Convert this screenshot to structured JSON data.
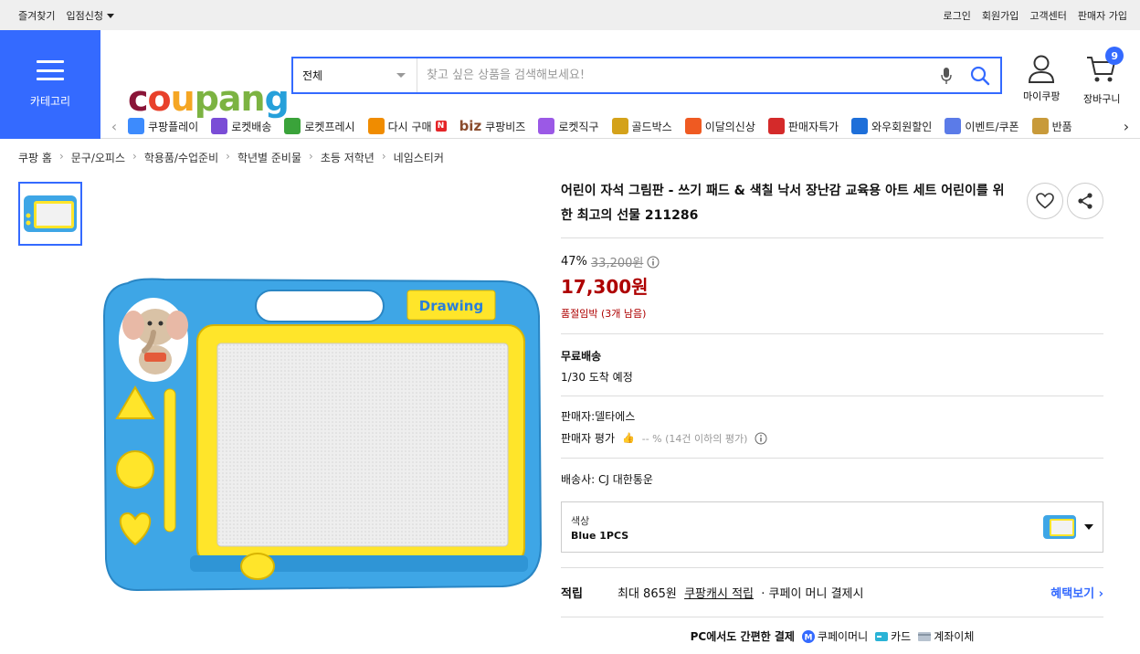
{
  "topbar": {
    "left": [
      "즐겨찾기",
      "입점신청"
    ],
    "right": [
      "로그인",
      "회원가입",
      "고객센터",
      "판매자 가입"
    ]
  },
  "header": {
    "category_label": "카테고리",
    "logo": {
      "c": "c",
      "o": "o",
      "u": "u",
      "pan": "pan",
      "g": "g"
    },
    "search": {
      "scope": "전체",
      "placeholder": "찾고 싶은 상품을 검색해보세요!"
    },
    "mycoupang_label": "마이쿠팡",
    "cart_label": "장바구니",
    "cart_count": "9"
  },
  "menu": {
    "items": [
      {
        "label": "쿠팡플레이",
        "color": "#3d8bfd"
      },
      {
        "label": "로켓배송",
        "color": "#7a4dd6"
      },
      {
        "label": "로켓프레시",
        "color": "#3aa33a"
      },
      {
        "label": "다시 구매",
        "color": "#f08c00",
        "badge": "N"
      },
      {
        "label": "쿠팡비즈",
        "prefix": "biz",
        "color": "#8a4b2c"
      },
      {
        "label": "로켓직구",
        "color": "#9b59e6"
      },
      {
        "label": "골드박스",
        "color": "#d4a21a"
      },
      {
        "label": "이달의신상",
        "color": "#ef5a22"
      },
      {
        "label": "판매자특가",
        "color": "#d42a2a"
      },
      {
        "label": "와우회원할인",
        "color": "#1e6fd9"
      },
      {
        "label": "이벤트/쿠폰",
        "color": "#5b7be8"
      },
      {
        "label": "반품",
        "color": "#c89a3a"
      }
    ]
  },
  "breadcrumb": [
    "쿠팡 홈",
    "문구/오피스",
    "학용품/수업준비",
    "학년별 준비물",
    "초등 저학년",
    "네임스티커"
  ],
  "product": {
    "title": "어린이 자석 그림판 - 쓰기 패드 & 색칠 낙서 장난감 교육용 아트 세트 어린이를 위한 최고의 선물 211286",
    "discount_rate": "47%",
    "original_price": "33,200원",
    "price": "17,300원",
    "stock_note": "품절임박 (3개 남음)",
    "shipping_label": "무료배송",
    "arrival": "1/30 도착 예정",
    "seller": "판매자:델타에스",
    "seller_rating_label": "판매자 평가",
    "seller_rating_value": "-- % (14건 이하의 평가)",
    "carrier": "배송사:  CJ 대한통운",
    "option_label": "색상",
    "option_value": "Blue 1PCS",
    "board_text": "Drawing",
    "reward_label": "적립",
    "reward_text_1": "최대 865원",
    "reward_link": "쿠팡캐시 적립",
    "reward_text_2": "· 쿠페이 머니 결제시",
    "reward_more": "혜택보기",
    "pay_heading": "PC에서도 간편한 결제",
    "pay_methods": [
      "쿠페이머니",
      "카드",
      "계좌이체"
    ]
  },
  "colors": {
    "accent": "#346aff",
    "price": "#ae0000",
    "board_blue": "#3ea6e6",
    "board_yellow": "#ffe52a"
  }
}
